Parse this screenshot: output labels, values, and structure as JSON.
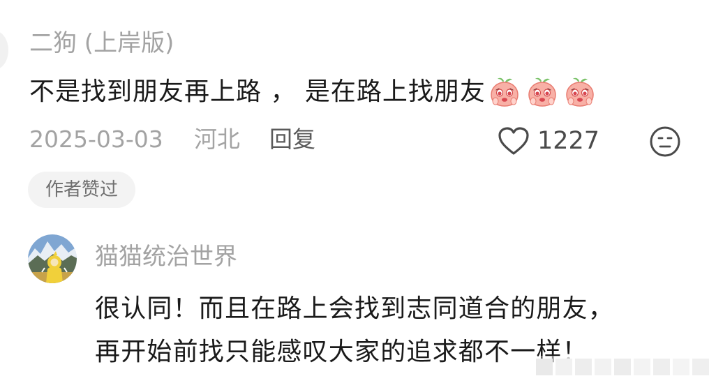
{
  "comment": {
    "username": "二狗 (上岸版)",
    "text": "不是找到朋友再上路 ， 是在路上找朋友",
    "emojis": [
      "peach-crying-emoji",
      "peach-crying-emoji",
      "peach-crying-emoji"
    ],
    "date": "2025-03-03",
    "location": "河北",
    "reply_label": "回复",
    "like_count": "1227",
    "author_badge": "作者赞过"
  },
  "reply": {
    "username": "猫猫统治世界",
    "line1": "很认同！而且在路上会找到志同道合的朋友，",
    "line2": "再开始前找只能感叹大家的追求都不一样！"
  },
  "colors": {
    "text": "#1a1a1a",
    "muted": "#a3a3a3",
    "badge_bg": "#f3f3f3",
    "badge_text": "#6f6f6f"
  }
}
